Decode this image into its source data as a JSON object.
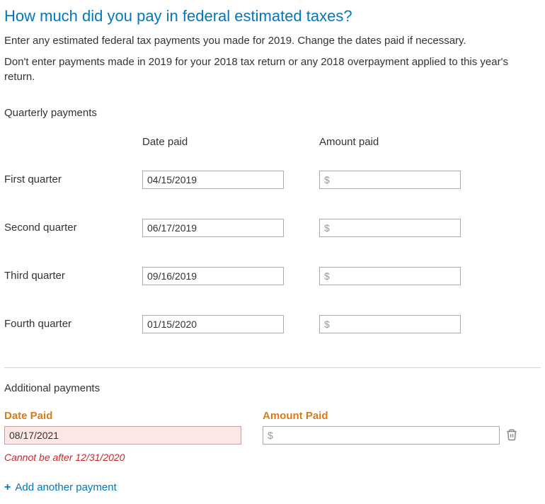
{
  "title": "How much did you pay in federal estimated taxes?",
  "intro1": "Enter any estimated federal tax payments you made for 2019. Change the dates paid if necessary.",
  "intro2": "Don't enter payments made in 2019 for your 2018 tax return or any 2018 overpayment applied to this year's return.",
  "quarterly_label": "Quarterly payments",
  "col_date": "Date paid",
  "col_amount": "Amount paid",
  "amount_placeholder": "$",
  "rows": {
    "q1": {
      "label": "First quarter",
      "date": "04/15/2019",
      "amount": ""
    },
    "q2": {
      "label": "Second quarter",
      "date": "06/17/2019",
      "amount": ""
    },
    "q3": {
      "label": "Third quarter",
      "date": "09/16/2019",
      "amount": ""
    },
    "q4": {
      "label": "Fourth quarter",
      "date": "01/15/2020",
      "amount": ""
    }
  },
  "additional": {
    "section_label": "Additional payments",
    "date_head": "Date Paid",
    "amount_head": "Amount Paid",
    "date_value": "08/17/2021",
    "amount_value": "",
    "error": "Cannot be after 12/31/2020"
  },
  "add_link": "Add another payment",
  "plus": "+"
}
